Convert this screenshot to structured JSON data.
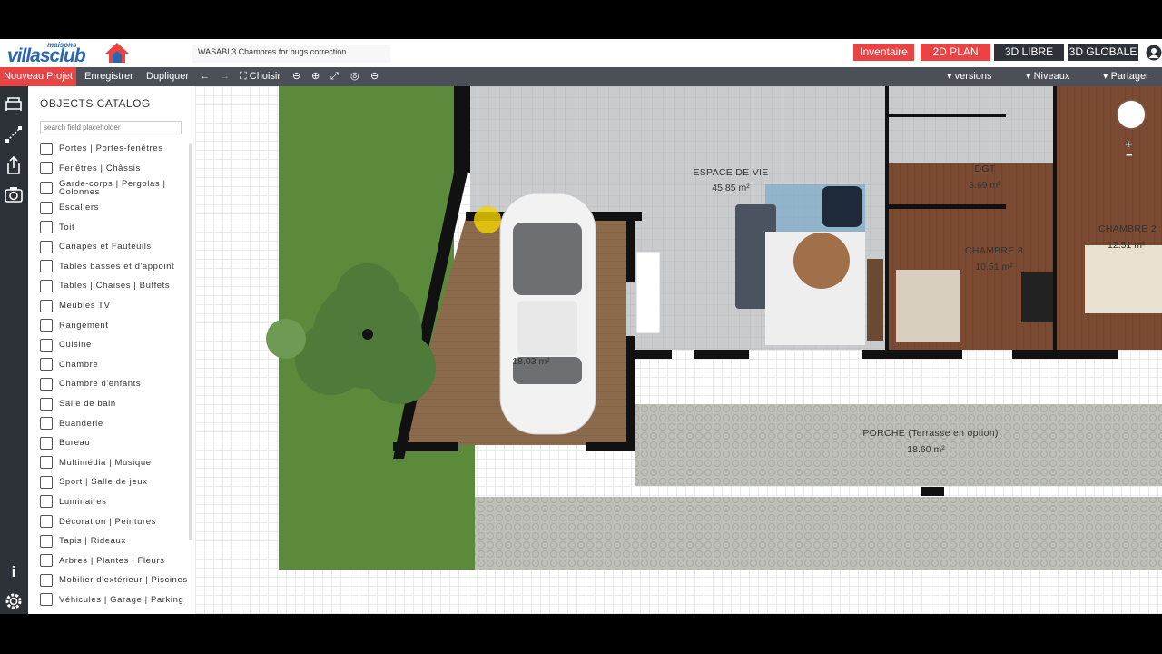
{
  "header": {
    "logo_small": "maisons",
    "logo_big": "villasclub",
    "project_name": "WASABI 3 Chambres for bugs correction",
    "inventaire": "Inventaire",
    "plan2d": "2D PLAN",
    "libre3d": "3D LIBRE",
    "globale3d": "3D GLOBALE"
  },
  "toolbar": {
    "nouveau": "Nouveau Projet",
    "enregistrer": "Enregistrer",
    "dupliquer": "Dupliquer",
    "back": "←",
    "forward": "→",
    "choisir": "Choisir",
    "zoom_out": "⊖",
    "zoom_in": "⊕",
    "fit": "⤢",
    "center": "◎",
    "minus": "⊖",
    "versions": "versions",
    "niveaux": "Niveaux",
    "partager": "Partager"
  },
  "catalog": {
    "title": "OBJECTS CATALOG",
    "search_placeholder": "search field placeholder",
    "items": [
      "Portes | Portes-fenêtres",
      "Fenêtres | Châssis",
      "Garde-corps | Pergolas | Colonnes",
      "Escaliers",
      "Toit",
      "Canapés et Fauteuils",
      "Tables basses et d'appoint",
      "Tables | Chaises | Buffets",
      "Meubles TV",
      "Rangement",
      "Cuisine",
      "Chambre",
      "Chambre d'enfants",
      "Salle de bain",
      "Buanderie",
      "Bureau",
      "Multimédia | Musique",
      "Sport | Salle de jeux",
      "Luminaires",
      "Décoration | Peintures",
      "Tapis | Rideaux",
      "Arbres | Plantes | Fleurs",
      "Mobilier d'extérieur | Piscines",
      "Véhicules | Garage | Parking"
    ]
  },
  "rooms": {
    "espace": {
      "name": "ESPACE DE VIE",
      "area": "45.85 m²"
    },
    "dgt": {
      "name": "DGT",
      "area": "3.69 m²"
    },
    "ch3": {
      "name": "CHAMBRE 3",
      "area": "10.51 m²"
    },
    "ch2": {
      "name": "CHAMBRE 2",
      "area": "12.51 m²"
    },
    "garage": {
      "area": "18.03 m²"
    },
    "porche": {
      "name": "PORCHE (Terrasse en option)",
      "area": "18.60 m²"
    }
  },
  "sidebar_icons": [
    "sofa-icon",
    "measure-icon",
    "export-icon",
    "camera-icon",
    "info-icon",
    "settings-icon"
  ],
  "colors": {
    "accent": "#e94343",
    "dark": "#2d3138",
    "toolbar": "#4b5058",
    "brand": "#2b67b0"
  }
}
